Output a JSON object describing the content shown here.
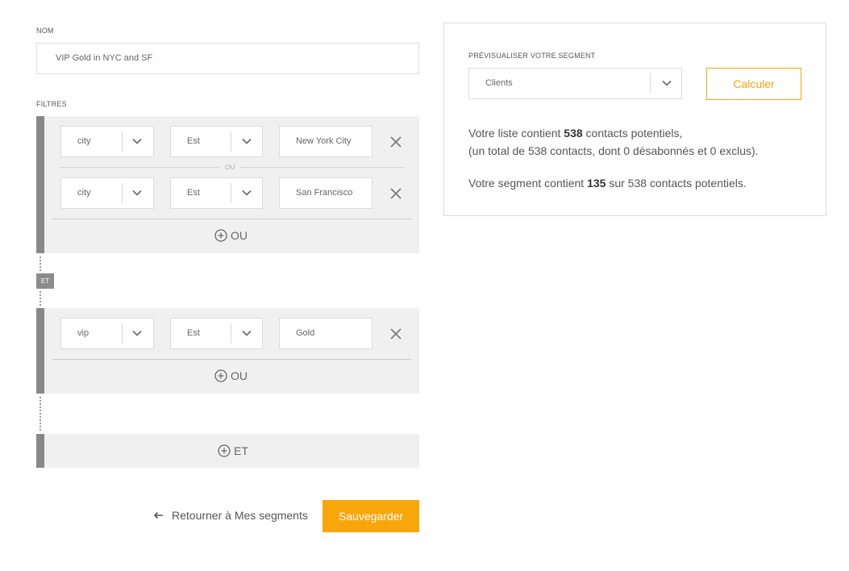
{
  "name_section": {
    "label": "NOM",
    "value": "VIP Gold in NYC and SF"
  },
  "filters_label": "FILTRES",
  "groups": [
    {
      "rows": [
        {
          "field": "city",
          "operator": "Est",
          "value": "New York City"
        },
        {
          "field": "city",
          "operator": "Est",
          "value": "San Francisco"
        }
      ],
      "or_separator": "OU",
      "add_or_label": "OU"
    },
    {
      "rows": [
        {
          "field": "vip",
          "operator": "Est",
          "value": "Gold"
        }
      ],
      "add_or_label": "OU"
    }
  ],
  "and_badge": "ET",
  "add_and_label": "ET",
  "footer": {
    "back_label": "Retourner à Mes segments",
    "save_label": "Sauvegarder"
  },
  "preview": {
    "label": "PRÉVISUALISER VOTRE SEGMENT",
    "list_select": "Clients",
    "calc_label": "Calculer",
    "line1_prefix": "Votre liste contient ",
    "line1_count": "538",
    "line1_suffix": " contacts potentiels,",
    "line2": "(un total de 538 contacts, dont 0 désabonnés et 0 exclus).",
    "line3_prefix": "Votre segment contient ",
    "line3_count": "135",
    "line3_suffix": " sur 538 contacts potentiels."
  },
  "colors": {
    "accent": "#f9a60c",
    "group_bar": "#888888",
    "group_bg": "#f0f0f0"
  }
}
